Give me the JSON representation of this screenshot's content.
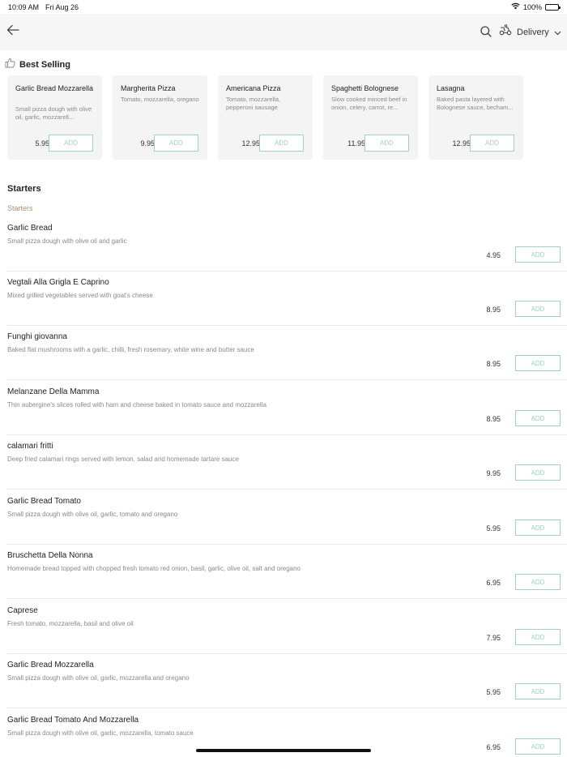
{
  "status_bar": {
    "time": "10:09 AM",
    "date": "Fri Aug 26",
    "battery": "100%"
  },
  "header": {
    "mode_label": "Delivery"
  },
  "best_selling": {
    "title": "Best Selling",
    "items": [
      {
        "name": "Garlic Bread Mozzarella",
        "desc": "Small pizza dough with olive oil, garlic, mozzarell...",
        "price": "5.95",
        "add": "ADD"
      },
      {
        "name": "Margherita Pizza",
        "desc": "Tomato, mozzarella, oregano",
        "price": "9.95",
        "add": "ADD"
      },
      {
        "name": "Americana Pizza",
        "desc": "Tomato, mozzarella, pepperoni sausage",
        "price": "12.95",
        "add": "ADD"
      },
      {
        "name": "Spaghetti Bolognese",
        "desc": "Slow cooked minced beef in onion, celery, carrot, re...",
        "price": "11.95",
        "add": "ADD"
      },
      {
        "name": "Lasagna",
        "desc": "Baked pasta layered with Bolognese sauce, becham...",
        "price": "12.95",
        "add": "ADD"
      }
    ]
  },
  "menu": {
    "section_title": "Starters",
    "subsection_title": "Starters",
    "items": [
      {
        "name": "Garlic Bread",
        "desc": "Small pizza dough with olive oil and garlic",
        "price": "4.95",
        "add": "ADD"
      },
      {
        "name": "Vegtali Alla Grigla E Caprino",
        "desc": "Mixed grilled vegetables served with goat's cheese",
        "price": "8.95",
        "add": "ADD"
      },
      {
        "name": "Funghi giovanna",
        "desc": "Baked flat mushrooms with a garlic, chilli, fresh rosemary, white wine and butter sauce",
        "price": "8.95",
        "add": "ADD"
      },
      {
        "name": "Melanzane Della Mamma",
        "desc": "Thin aubergine's slices rolled with ham and cheese baked in tomato sauce and mozzarella",
        "price": "8.95",
        "add": "ADD"
      },
      {
        "name": "calamari fritti",
        "desc": "Deep fried calamari rings served with lemon, salad and homemade tartare sauce",
        "price": "9.95",
        "add": "ADD"
      },
      {
        "name": "Garlic Bread Tomato",
        "desc": "Small pizza dough with olive oil, garlic, tomato and oregano",
        "price": "5.95",
        "add": "ADD"
      },
      {
        "name": "Bruschetta Della Nonna",
        "desc": "Homemade bread topped with chopped fresh tomato red onion, basil, garlic, olive oil, salt and oregano",
        "price": "6.95",
        "add": "ADD"
      },
      {
        "name": "Caprese",
        "desc": "Fresh tomato, mozzarella, basil and olive oil",
        "price": "7.95",
        "add": "ADD"
      },
      {
        "name": "Garlic Bread Mozzarella",
        "desc": "Small pizza dough with olive oil, garlic, mozzarella and oregano",
        "price": "5.95",
        "add": "ADD"
      },
      {
        "name": "Garlic Bread Tomato And Mozzarella",
        "desc": "Small pizza dough with olive oil, garlic, mozzarella, tomato sauce",
        "price": "6.95",
        "add": "ADD"
      }
    ]
  },
  "colors": {
    "accent": "#9fd4ba",
    "subsection": "#b3906c",
    "card_bg": "#f4f4f4",
    "nav_bg": "#f6f6f6"
  }
}
